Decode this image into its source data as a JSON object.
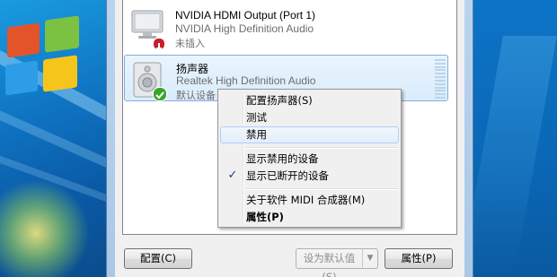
{
  "devices": [
    {
      "name": "NVIDIA HDMI Output (Port 1)",
      "driver": "NVIDIA High Definition Audio",
      "status": "未插入",
      "icon": "monitor-icon",
      "badge_icon": "unplugged-badge-icon",
      "selected": false
    },
    {
      "name": "扬声器",
      "driver": "Realtek High Definition Audio",
      "status": "默认设备",
      "icon": "speaker-icon",
      "badge_icon": "default-check-badge-icon",
      "selected": true
    }
  ],
  "context_menu": {
    "items": [
      {
        "label": "配置扬声器(S)"
      },
      {
        "label": "测试"
      },
      {
        "label": "禁用",
        "highlighted": true
      },
      {
        "label": "显示禁用的设备"
      },
      {
        "label": "显示已断开的设备",
        "checked": true,
        "check_mark": "✓"
      },
      {
        "label": "关于软件 MIDI 合成器(M)"
      },
      {
        "label": "属性(P)",
        "bold": true
      }
    ]
  },
  "buttons": {
    "configure": "配置(C)",
    "set_default": "设为默认值(S)",
    "set_default_arrow": "▼",
    "properties": "属性(P)"
  },
  "colors": {
    "selection_bg": "#d9ecfc",
    "selection_border": "#84acdd",
    "check_green": "#3aa52e",
    "unplugged_red": "#c8202a"
  }
}
